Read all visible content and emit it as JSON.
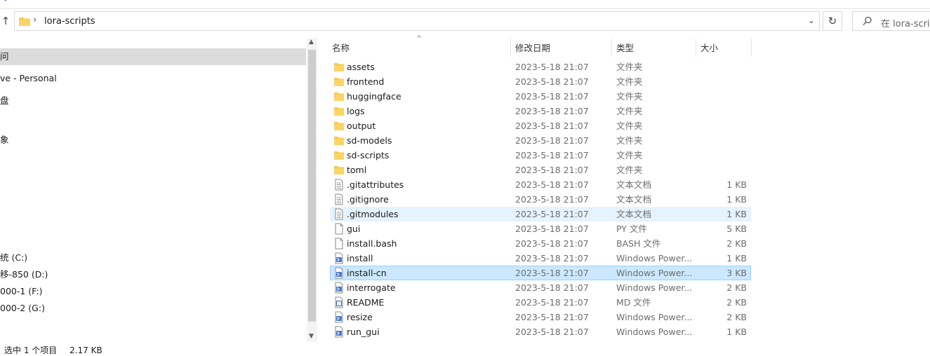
{
  "address": {
    "path": "lora-scripts",
    "separator": "›"
  },
  "search": {
    "placeholder": "在 lora-scrip"
  },
  "nav": [
    {
      "label": "问"
    },
    {
      "label": "ve - Personal"
    },
    {
      "label": "盘"
    },
    {
      "label": "象"
    },
    {
      "label": "统 (C:)"
    },
    {
      "label": "移-850 (D:)"
    },
    {
      "label": "000-1 (F:)"
    },
    {
      "label": "000-2 (G:)"
    }
  ],
  "columns": {
    "name": "名称",
    "date": "修改日期",
    "type": "类型",
    "size": "大小"
  },
  "files": [
    {
      "name": "assets",
      "date": "2023-5-18 21:07",
      "type": "文件夹",
      "size": "",
      "icon": "folder"
    },
    {
      "name": "frontend",
      "date": "2023-5-18 21:07",
      "type": "文件夹",
      "size": "",
      "icon": "folder"
    },
    {
      "name": "huggingface",
      "date": "2023-5-18 21:07",
      "type": "文件夹",
      "size": "",
      "icon": "folder"
    },
    {
      "name": "logs",
      "date": "2023-5-18 21:07",
      "type": "文件夹",
      "size": "",
      "icon": "folder"
    },
    {
      "name": "output",
      "date": "2023-5-18 21:07",
      "type": "文件夹",
      "size": "",
      "icon": "folder"
    },
    {
      "name": "sd-models",
      "date": "2023-5-18 21:07",
      "type": "文件夹",
      "size": "",
      "icon": "folder"
    },
    {
      "name": "sd-scripts",
      "date": "2023-5-18 21:07",
      "type": "文件夹",
      "size": "",
      "icon": "folder"
    },
    {
      "name": "toml",
      "date": "2023-5-18 21:07",
      "type": "文件夹",
      "size": "",
      "icon": "folder"
    },
    {
      "name": ".gitattributes",
      "date": "2023-5-18 21:07",
      "type": "文本文档",
      "size": "1 KB",
      "icon": "text"
    },
    {
      "name": ".gitignore",
      "date": "2023-5-18 21:07",
      "type": "文本文档",
      "size": "1 KB",
      "icon": "text"
    },
    {
      "name": ".gitmodules",
      "date": "2023-5-18 21:07",
      "type": "文本文档",
      "size": "1 KB",
      "icon": "text"
    },
    {
      "name": "gui",
      "date": "2023-5-18 21:07",
      "type": "PY 文件",
      "size": "5 KB",
      "icon": "blank"
    },
    {
      "name": "install.bash",
      "date": "2023-5-18 21:07",
      "type": "BASH 文件",
      "size": "2 KB",
      "icon": "blank"
    },
    {
      "name": "install",
      "date": "2023-5-18 21:07",
      "type": "Windows Power...",
      "size": "1 KB",
      "icon": "ps"
    },
    {
      "name": "install-cn",
      "date": "2023-5-18 21:07",
      "type": "Windows Power...",
      "size": "3 KB",
      "icon": "ps"
    },
    {
      "name": "interrogate",
      "date": "2023-5-18 21:07",
      "type": "Windows Power...",
      "size": "2 KB",
      "icon": "ps"
    },
    {
      "name": "README",
      "date": "2023-5-18 21:07",
      "type": "MD 文件",
      "size": "2 KB",
      "icon": "md"
    },
    {
      "name": "resize",
      "date": "2023-5-18 21:07",
      "type": "Windows Power...",
      "size": "2 KB",
      "icon": "ps"
    },
    {
      "name": "run_gui",
      "date": "2023-5-18 21:07",
      "type": "Windows Power...",
      "size": "1 KB",
      "icon": "ps"
    }
  ],
  "status": {
    "selection": "选中 1 个项目",
    "size": "2.17 KB"
  },
  "colors": {
    "folder": "#f8c94a",
    "selected_row": "#cce8ff",
    "hover_row": "#e5f3ff"
  }
}
